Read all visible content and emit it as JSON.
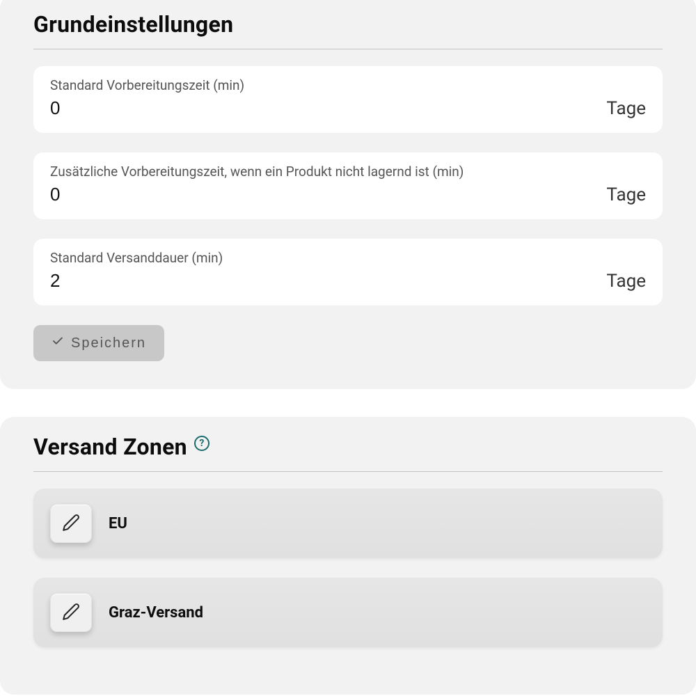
{
  "basic_settings": {
    "title": "Grundeinstellungen",
    "fields": [
      {
        "label": "Standard Vorbereitungszeit (min)",
        "value": "0",
        "unit": "Tage"
      },
      {
        "label": "Zusätzliche Vorbereitungszeit, wenn ein Produkt nicht lagernd ist (min)",
        "value": "0",
        "unit": "Tage"
      },
      {
        "label": "Standard Versanddauer (min)",
        "value": "2",
        "unit": "Tage"
      }
    ],
    "save_label": "Speichern"
  },
  "shipping_zones": {
    "title": "Versand Zonen",
    "help": "?",
    "items": [
      {
        "name": "EU"
      },
      {
        "name": "Graz-Versand"
      }
    ]
  }
}
